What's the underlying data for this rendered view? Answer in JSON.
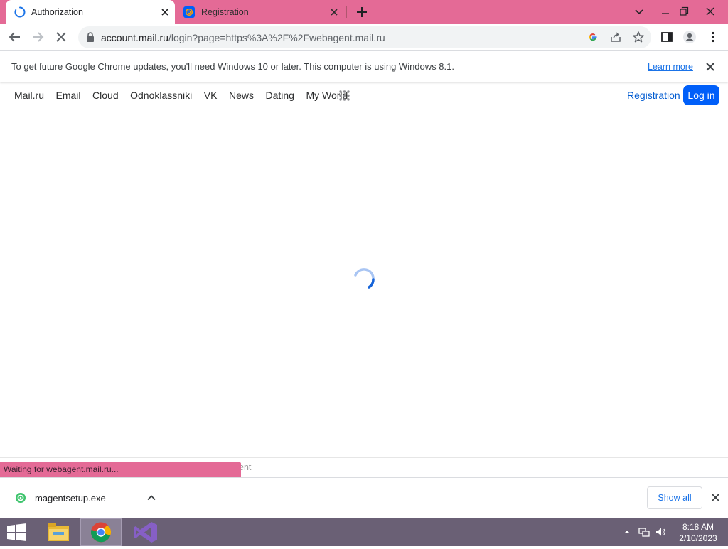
{
  "colors": {
    "frame": "#e46a96",
    "accent_blue": "#1a73e8",
    "mailru_blue": "#005ff9",
    "taskbar": "#6a6075"
  },
  "browser": {
    "tabs": [
      {
        "label": "Authorization",
        "active": true,
        "icon": "loading-spinner-icon"
      },
      {
        "label": "Registration",
        "active": false,
        "icon": "mailru-at-icon"
      }
    ],
    "toolbar": {
      "url_host": "account.mail.ru",
      "url_path": "/login?page=https%3A%2F%2Fwebagent.mail.ru"
    },
    "infobar": {
      "message": "To get future Google Chrome updates, you'll need Windows 10 or later. This computer is using Windows 8.1.",
      "link": "Learn more"
    }
  },
  "site": {
    "nav_links": [
      "Mail.ru",
      "Email",
      "Cloud",
      "Odnoklassniki",
      "VK",
      "News",
      "Dating",
      "My World"
    ],
    "registration": "Registration",
    "login": "Log in"
  },
  "page": {
    "ghost_text": "ent",
    "status": "Waiting for webagent.mail.ru..."
  },
  "downloads": {
    "filename": "magentsetup.exe",
    "show_all": "Show all"
  },
  "taskbar": {
    "time": "8:18 AM",
    "date": "2/10/2023"
  }
}
